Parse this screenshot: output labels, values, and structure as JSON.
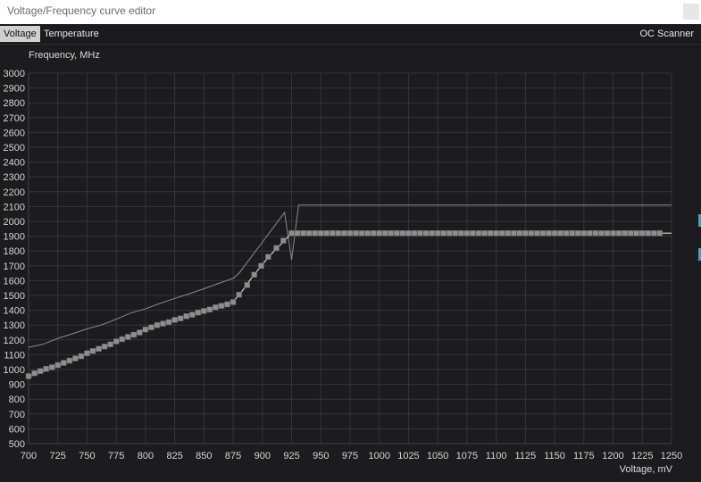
{
  "window": {
    "title": "Voltage/Frequency curve editor"
  },
  "tabs": [
    {
      "label": "Voltage",
      "active": true
    },
    {
      "label": "Temperature",
      "active": false
    }
  ],
  "oc_scanner_label": "OC Scanner",
  "colors": {
    "background": "#1c1c1f",
    "grid": "#34343a",
    "curve": "#c8c8c8",
    "point": "#8e8e8e",
    "accent": "#3ba6c4"
  },
  "chart_data": {
    "type": "line",
    "xlabel": "Voltage, mV",
    "ylabel": "Frequency, MHz",
    "xlim": [
      700,
      1250
    ],
    "ylim": [
      500,
      3000
    ],
    "x_ticks": [
      700,
      725,
      750,
      775,
      800,
      825,
      850,
      875,
      900,
      925,
      950,
      975,
      1000,
      1025,
      1050,
      1075,
      1100,
      1125,
      1150,
      1175,
      1200,
      1225,
      1250
    ],
    "y_ticks": [
      500,
      600,
      700,
      800,
      900,
      1000,
      1100,
      1200,
      1300,
      1400,
      1500,
      1600,
      1700,
      1800,
      1900,
      2000,
      2100,
      2200,
      2300,
      2400,
      2500,
      2600,
      2700,
      2800,
      2900,
      3000
    ],
    "grid": true,
    "series": [
      {
        "role": "reference",
        "points": [
          [
            700,
            1150
          ],
          [
            712,
            1170
          ],
          [
            725,
            1210
          ],
          [
            737,
            1240
          ],
          [
            750,
            1275
          ],
          [
            762,
            1300
          ],
          [
            775,
            1340
          ],
          [
            787,
            1380
          ],
          [
            800,
            1410
          ],
          [
            812,
            1445
          ],
          [
            825,
            1480
          ],
          [
            837,
            1510
          ],
          [
            850,
            1545
          ],
          [
            862,
            1580
          ],
          [
            875,
            1615
          ],
          [
            880,
            1650
          ],
          [
            900,
            1860
          ],
          [
            919,
            2060
          ],
          [
            925,
            1740
          ],
          [
            931,
            2110
          ],
          [
            1250,
            2110
          ]
        ]
      },
      {
        "role": "curve",
        "points": [
          [
            700,
            950
          ],
          [
            725,
            1020
          ],
          [
            750,
            1110
          ],
          [
            775,
            1190
          ],
          [
            800,
            1275
          ],
          [
            825,
            1340
          ],
          [
            850,
            1400
          ],
          [
            875,
            1460
          ],
          [
            880,
            1500
          ],
          [
            890,
            1610
          ],
          [
            900,
            1710
          ],
          [
            910,
            1800
          ],
          [
            919,
            1870
          ],
          [
            925,
            1920
          ],
          [
            1250,
            1920
          ]
        ],
        "markers": [
          [
            700,
            955
          ],
          [
            705,
            975
          ],
          [
            710,
            990
          ],
          [
            715,
            1005
          ],
          [
            720,
            1015
          ],
          [
            725,
            1030
          ],
          [
            730,
            1045
          ],
          [
            735,
            1060
          ],
          [
            740,
            1075
          ],
          [
            745,
            1090
          ],
          [
            750,
            1110
          ],
          [
            755,
            1125
          ],
          [
            760,
            1140
          ],
          [
            765,
            1155
          ],
          [
            770,
            1170
          ],
          [
            775,
            1190
          ],
          [
            780,
            1205
          ],
          [
            785,
            1220
          ],
          [
            790,
            1235
          ],
          [
            795,
            1250
          ],
          [
            800,
            1270
          ],
          [
            805,
            1285
          ],
          [
            810,
            1300
          ],
          [
            815,
            1310
          ],
          [
            820,
            1320
          ],
          [
            825,
            1335
          ],
          [
            830,
            1345
          ],
          [
            835,
            1360
          ],
          [
            840,
            1370
          ],
          [
            845,
            1385
          ],
          [
            850,
            1395
          ],
          [
            855,
            1405
          ],
          [
            860,
            1420
          ],
          [
            865,
            1430
          ],
          [
            870,
            1440
          ],
          [
            875,
            1455
          ],
          [
            880,
            1505
          ],
          [
            887,
            1570
          ],
          [
            893,
            1640
          ],
          [
            899,
            1700
          ],
          [
            905,
            1760
          ],
          [
            912,
            1820
          ],
          [
            918,
            1870
          ],
          [
            925,
            1920
          ],
          [
            930,
            1920
          ],
          [
            935,
            1920
          ],
          [
            940,
            1920
          ],
          [
            945,
            1920
          ],
          [
            950,
            1920
          ],
          [
            955,
            1920
          ],
          [
            960,
            1920
          ],
          [
            965,
            1920
          ],
          [
            970,
            1920
          ],
          [
            975,
            1920
          ],
          [
            980,
            1920
          ],
          [
            985,
            1920
          ],
          [
            990,
            1920
          ],
          [
            995,
            1920
          ],
          [
            1000,
            1920
          ],
          [
            1005,
            1920
          ],
          [
            1010,
            1920
          ],
          [
            1015,
            1920
          ],
          [
            1020,
            1920
          ],
          [
            1025,
            1920
          ],
          [
            1030,
            1920
          ],
          [
            1035,
            1920
          ],
          [
            1040,
            1920
          ],
          [
            1045,
            1920
          ],
          [
            1050,
            1920
          ],
          [
            1055,
            1920
          ],
          [
            1060,
            1920
          ],
          [
            1065,
            1920
          ],
          [
            1070,
            1920
          ],
          [
            1075,
            1920
          ],
          [
            1080,
            1920
          ],
          [
            1085,
            1920
          ],
          [
            1090,
            1920
          ],
          [
            1095,
            1920
          ],
          [
            1100,
            1920
          ],
          [
            1105,
            1920
          ],
          [
            1110,
            1920
          ],
          [
            1115,
            1920
          ],
          [
            1120,
            1920
          ],
          [
            1125,
            1920
          ],
          [
            1130,
            1920
          ],
          [
            1135,
            1920
          ],
          [
            1140,
            1920
          ],
          [
            1145,
            1920
          ],
          [
            1150,
            1920
          ],
          [
            1155,
            1920
          ],
          [
            1160,
            1920
          ],
          [
            1165,
            1920
          ],
          [
            1170,
            1920
          ],
          [
            1175,
            1920
          ],
          [
            1180,
            1920
          ],
          [
            1185,
            1920
          ],
          [
            1190,
            1920
          ],
          [
            1195,
            1920
          ],
          [
            1200,
            1920
          ],
          [
            1205,
            1920
          ],
          [
            1210,
            1920
          ],
          [
            1215,
            1920
          ],
          [
            1220,
            1920
          ],
          [
            1225,
            1920
          ],
          [
            1230,
            1920
          ],
          [
            1235,
            1920
          ],
          [
            1240,
            1920
          ]
        ]
      }
    ]
  }
}
